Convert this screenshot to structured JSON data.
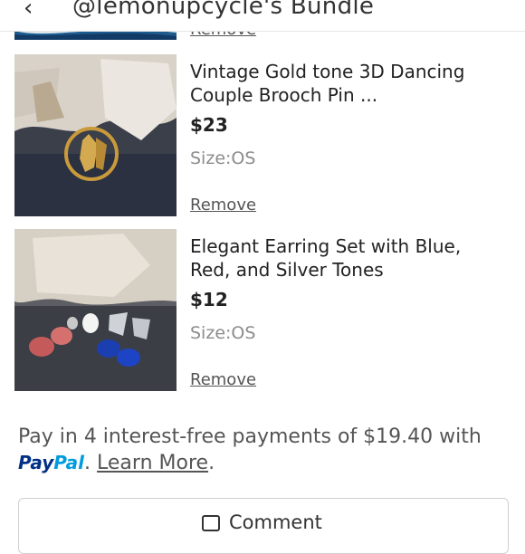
{
  "header": {
    "title": "@lemonupcycle's Bundle",
    "back_icon": "chevron-left-icon"
  },
  "previous_item": {
    "remove_label": "Remove"
  },
  "items": [
    {
      "title": "Vintage Gold tone 3D Dancing Couple Brooch Pin ...",
      "price": "$23",
      "size": "Size:OS",
      "remove_label": "Remove"
    },
    {
      "title": "Elegant Earring Set with Blue, Red, and Silver Tones",
      "price": "$12",
      "size": "Size:OS",
      "remove_label": "Remove"
    }
  ],
  "paypal": {
    "prefix": "Pay in 4 interest-free payments of $19.40 with",
    "logo_pay": "Pay",
    "logo_pal": "Pal",
    "sep": ". ",
    "learn_more": "Learn More",
    "suffix": "."
  },
  "comment_button": {
    "label": "Comment",
    "icon": "comment-icon"
  },
  "colors": {
    "paypal_dark": "#003087",
    "paypal_light": "#009cde",
    "muted_text": "#8c8c8c"
  }
}
